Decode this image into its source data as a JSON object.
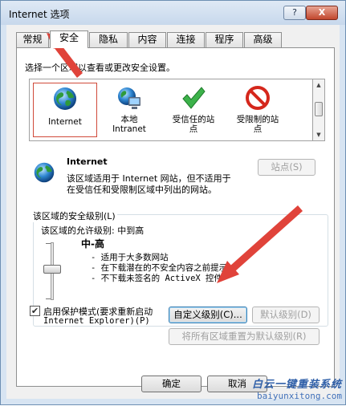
{
  "window": {
    "title": "Internet 选项",
    "help_label": "?",
    "close_label": "X"
  },
  "tabs": [
    {
      "label": "常规"
    },
    {
      "label": "安全",
      "active": true
    },
    {
      "label": "隐私"
    },
    {
      "label": "内容"
    },
    {
      "label": "连接"
    },
    {
      "label": "程序"
    },
    {
      "label": "高级"
    }
  ],
  "security": {
    "zone_prompt": "选择一个区域以查看或更改安全设置。",
    "zones": [
      {
        "label": "Internet",
        "icon": "globe-icon",
        "selected": true
      },
      {
        "label": "本地\nIntranet",
        "icon": "local-intranet-icon"
      },
      {
        "label": "受信任的站\n点",
        "icon": "check-icon"
      },
      {
        "label": "受限制的站\n点",
        "icon": "restricted-icon"
      }
    ],
    "zone_title": "Internet",
    "zone_desc_1": "该区域适用于 Internet 网站，但不适用于",
    "zone_desc_2": "在受信任和受限制区域中列出的网站。",
    "sites_button": "站点(S)",
    "level_group_label": "该区域的安全级别(L)",
    "allowed_levels": "该区域的允许级别: 中到高",
    "level_name": "中-高",
    "level_bullets": [
      "- 适用于大多数网站",
      "- 在下载潜在的不安全内容之前提示",
      "- 不下载未签名的 ActiveX 控件"
    ],
    "protected_mode_1": "启用保护模式(要求重新启动",
    "protected_mode_2": "Internet Explorer)(P)",
    "protected_mode_checked": true,
    "custom_level_button": "自定义级别(C)...",
    "default_level_button": "默认级别(D)",
    "reset_all_button": "将所有区域重置为默认级别(R)"
  },
  "footer": {
    "ok_button": "确定",
    "cancel_button": "取消"
  },
  "watermark": {
    "text": "白云一键重装系统",
    "url": "baiyunxitong.com"
  },
  "colors": {
    "accent_red": "#e0433a",
    "selection_border": "#d04a3a"
  }
}
